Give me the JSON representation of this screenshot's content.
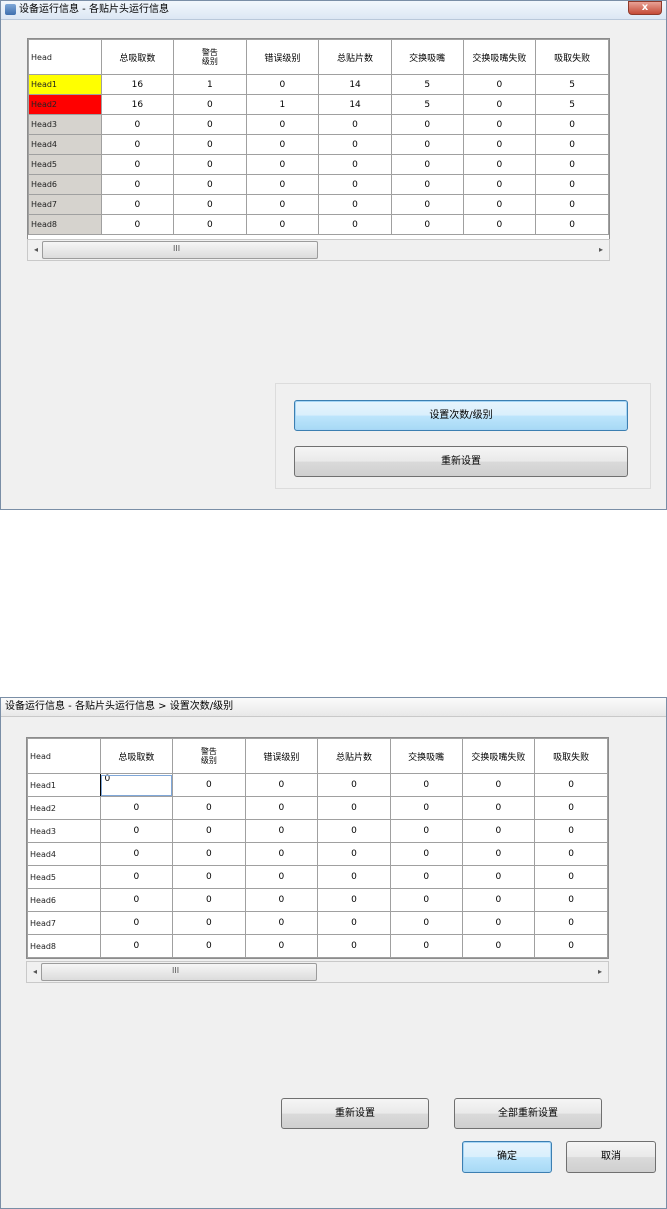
{
  "dialog1": {
    "title": "设备运行信息 - 各贴片头运行信息",
    "close_label": "x",
    "columns": [
      "Head",
      "总吸取数",
      "警告级别",
      "错误级别",
      "总贴片数",
      "交换吸嘴",
      "交换吸嘴失败",
      "吸取失败"
    ],
    "rows": [
      {
        "head": "Head1",
        "values": [
          "16",
          "1",
          "0",
          "14",
          "5",
          "0",
          "5"
        ],
        "highlight": "yellow"
      },
      {
        "head": "Head2",
        "values": [
          "16",
          "0",
          "1",
          "14",
          "5",
          "0",
          "5"
        ],
        "highlight": "red"
      },
      {
        "head": "Head3",
        "values": [
          "0",
          "0",
          "0",
          "0",
          "0",
          "0",
          "0"
        ]
      },
      {
        "head": "Head4",
        "values": [
          "0",
          "0",
          "0",
          "0",
          "0",
          "0",
          "0"
        ]
      },
      {
        "head": "Head5",
        "values": [
          "0",
          "0",
          "0",
          "0",
          "0",
          "0",
          "0"
        ]
      },
      {
        "head": "Head6",
        "values": [
          "0",
          "0",
          "0",
          "0",
          "0",
          "0",
          "0"
        ]
      },
      {
        "head": "Head7",
        "values": [
          "0",
          "0",
          "0",
          "0",
          "0",
          "0",
          "0"
        ]
      },
      {
        "head": "Head8",
        "values": [
          "0",
          "0",
          "0",
          "0",
          "0",
          "0",
          "0"
        ]
      }
    ],
    "scroll_grip": "III",
    "set_count_level_button": "设置次数/级别",
    "reset_button": "重新设置",
    "colors": {
      "highlight_yellow": "#ffff00",
      "highlight_red": "#ff0000",
      "focus_border": "#3c7fb1"
    }
  },
  "dialog2": {
    "title": "设备运行信息 - 各贴片头运行信息 > 设置次数/级别",
    "columns": [
      "Head",
      "总吸取数",
      "警告级别",
      "错误级别",
      "总贴片数",
      "交换吸嘴",
      "交换吸嘴失败",
      "吸取失败"
    ],
    "rows": [
      {
        "head": "Head1",
        "values": [
          "0",
          "0",
          "0",
          "0",
          "0",
          "0",
          "0"
        ],
        "editing_value": "0"
      },
      {
        "head": "Head2",
        "values": [
          "0",
          "0",
          "0",
          "0",
          "0",
          "0",
          "0"
        ]
      },
      {
        "head": "Head3",
        "values": [
          "0",
          "0",
          "0",
          "0",
          "0",
          "0",
          "0"
        ]
      },
      {
        "head": "Head4",
        "values": [
          "0",
          "0",
          "0",
          "0",
          "0",
          "0",
          "0"
        ]
      },
      {
        "head": "Head5",
        "values": [
          "0",
          "0",
          "0",
          "0",
          "0",
          "0",
          "0"
        ]
      },
      {
        "head": "Head6",
        "values": [
          "0",
          "0",
          "0",
          "0",
          "0",
          "0",
          "0"
        ]
      },
      {
        "head": "Head7",
        "values": [
          "0",
          "0",
          "0",
          "0",
          "0",
          "0",
          "0"
        ]
      },
      {
        "head": "Head8",
        "values": [
          "0",
          "0",
          "0",
          "0",
          "0",
          "0",
          "0"
        ]
      }
    ],
    "scroll_grip": "III",
    "reset_button": "重新设置",
    "reset_all_button": "全部重新设置",
    "ok_button": "确定",
    "cancel_button": "取消"
  }
}
